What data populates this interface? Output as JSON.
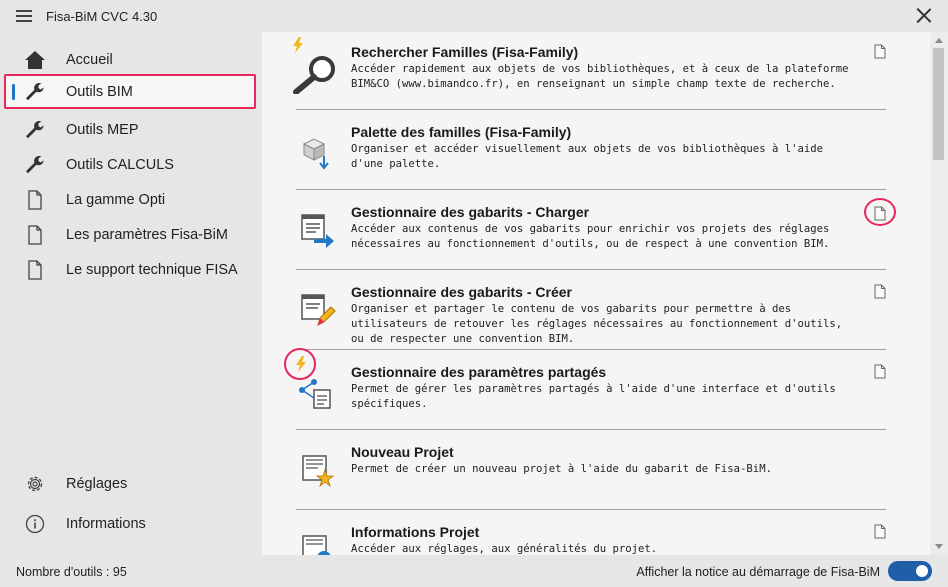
{
  "app": {
    "title": "Fisa-BiM CVC 4.30"
  },
  "sidebar": {
    "items": [
      {
        "label": "Accueil",
        "icon": "home-icon"
      },
      {
        "label": "Outils BIM",
        "icon": "wrench-icon",
        "active": true
      },
      {
        "label": "Outils MEP",
        "icon": "wrench-icon"
      },
      {
        "label": "Outils CALCULS",
        "icon": "wrench-icon"
      },
      {
        "label": "La gamme Opti",
        "icon": "document-icon"
      },
      {
        "label": "Les paramètres Fisa-BiM",
        "icon": "document-icon"
      },
      {
        "label": "Le support technique FISA",
        "icon": "document-icon"
      }
    ],
    "bottom": [
      {
        "label": "Réglages",
        "icon": "gear-icon"
      },
      {
        "label": "Informations",
        "icon": "info-icon"
      }
    ]
  },
  "tools": [
    {
      "title": "Rechercher Familles (Fisa-Family)",
      "desc": "Accéder rapidement aux objets de vos bibliothèques, et à ceux de la plateforme BIM&CO (www.bimandco.fr), en renseignant un simple champ texte de recherche."
    },
    {
      "title": "Palette des familles (Fisa-Family)",
      "desc": "Organiser et accéder visuellement aux objets de vos bibliothèques à l'aide d'une palette."
    },
    {
      "title": "Gestionnaire des gabarits - Charger",
      "desc": "Accéder aux contenus de vos gabarits pour enrichir vos projets des réglages nécessaires au fonctionnement d'outils, ou de respect à une convention BIM."
    },
    {
      "title": "Gestionnaire des gabarits - Créer",
      "desc": "Organiser et partager le contenu de vos gabarits pour permettre à des utilisateurs de retouver les réglages nécessaires au fonctionnement d'outils, ou de respecter une convention BIM."
    },
    {
      "title": "Gestionnaire des paramètres partagés",
      "desc": "Permet de gérer les paramètres partagés à l'aide d'une interface et d'outils spécifiques."
    },
    {
      "title": "Nouveau Projet",
      "desc": "Permet de créer un nouveau projet à l'aide du gabarit de Fisa-BiM."
    },
    {
      "title": "Informations Projet",
      "desc": "Accéder aux réglages, aux généralités du projet."
    }
  ],
  "status": {
    "tool_count": "Nombre d'outils : 95",
    "notice_label": "Afficher la notice au démarrage de Fisa-BiM",
    "notice_on": true
  },
  "colors": {
    "highlight": "#e8265a",
    "accent": "#1a73c9",
    "toggle": "#1e5fa8",
    "lightning": "#f2b51d"
  }
}
